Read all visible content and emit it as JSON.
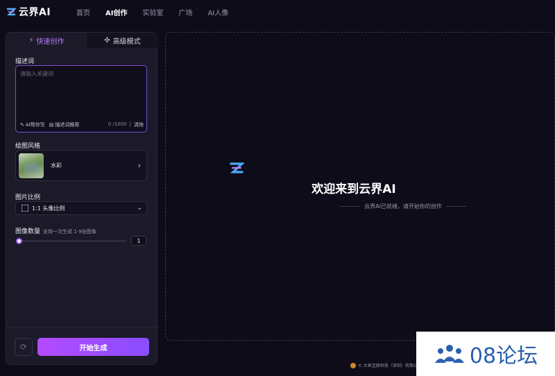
{
  "app": {
    "logo_text": "云界AI"
  },
  "nav": {
    "items": [
      "首页",
      "AI创作",
      "实验室",
      "广场",
      "AI人像"
    ],
    "active_index": 1
  },
  "tabs": {
    "quick": "快速创作",
    "advanced": "高级模式"
  },
  "prompt": {
    "label": "描述词",
    "placeholder": "请输入关键词",
    "ai_write": "AI帮你写",
    "recommend": "描述词推荐",
    "counter": "0 /1000",
    "clear": "清除"
  },
  "style": {
    "label": "绘图风格",
    "name": "水彩"
  },
  "ratio": {
    "label": "图片比例",
    "value": "1:1 头像比例"
  },
  "count": {
    "label": "图像数量",
    "hint": "支持一次生成 1-9张图像",
    "value": "1",
    "min": 1,
    "max": 9
  },
  "actions": {
    "generate": "开始生成"
  },
  "canvas": {
    "title": "欢迎来到云界AI",
    "subtitle": "云界AI已就绪，请开始你的创作"
  },
  "footer": {
    "company": "© 大鱼互联科技（深圳）有限公司"
  },
  "watermark": {
    "text": "08论坛"
  },
  "colors": {
    "accent": "#9a5cff",
    "background": "#0f0c1a",
    "panel": "#1c1a29"
  }
}
